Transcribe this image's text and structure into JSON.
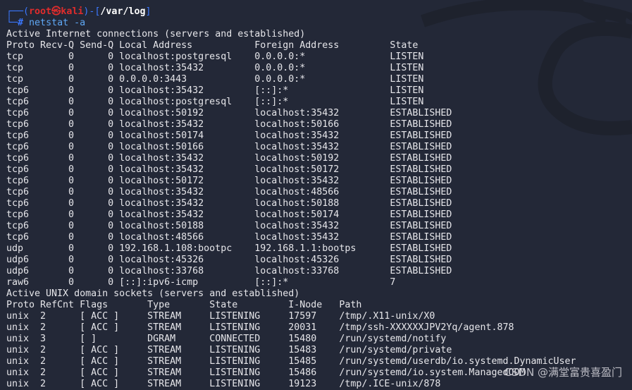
{
  "prompt": {
    "user": "root",
    "at_symbol": "㉿",
    "host": "kali",
    "cwd": "/var/log",
    "command": "netstat -a"
  },
  "inet": {
    "title": "Active Internet connections (servers and established)",
    "headers": [
      "Proto",
      "Recv-Q",
      "Send-Q",
      "Local Address",
      "Foreign Address",
      "State"
    ],
    "rows": [
      [
        "tcp",
        "0",
        "0",
        "localhost:postgresql",
        "0.0.0.0:*",
        "LISTEN"
      ],
      [
        "tcp",
        "0",
        "0",
        "localhost:35432",
        "0.0.0.0:*",
        "LISTEN"
      ],
      [
        "tcp",
        "0",
        "0",
        "0.0.0.0:3443",
        "0.0.0.0:*",
        "LISTEN"
      ],
      [
        "tcp6",
        "0",
        "0",
        "localhost:35432",
        "[::]:*",
        "LISTEN"
      ],
      [
        "tcp6",
        "0",
        "0",
        "localhost:postgresql",
        "[::]:*",
        "LISTEN"
      ],
      [
        "tcp6",
        "0",
        "0",
        "localhost:50192",
        "localhost:35432",
        "ESTABLISHED"
      ],
      [
        "tcp6",
        "0",
        "0",
        "localhost:35432",
        "localhost:50166",
        "ESTABLISHED"
      ],
      [
        "tcp6",
        "0",
        "0",
        "localhost:50174",
        "localhost:35432",
        "ESTABLISHED"
      ],
      [
        "tcp6",
        "0",
        "0",
        "localhost:50166",
        "localhost:35432",
        "ESTABLISHED"
      ],
      [
        "tcp6",
        "0",
        "0",
        "localhost:35432",
        "localhost:50192",
        "ESTABLISHED"
      ],
      [
        "tcp6",
        "0",
        "0",
        "localhost:35432",
        "localhost:50172",
        "ESTABLISHED"
      ],
      [
        "tcp6",
        "0",
        "0",
        "localhost:50172",
        "localhost:35432",
        "ESTABLISHED"
      ],
      [
        "tcp6",
        "0",
        "0",
        "localhost:35432",
        "localhost:48566",
        "ESTABLISHED"
      ],
      [
        "tcp6",
        "0",
        "0",
        "localhost:35432",
        "localhost:50188",
        "ESTABLISHED"
      ],
      [
        "tcp6",
        "0",
        "0",
        "localhost:35432",
        "localhost:50174",
        "ESTABLISHED"
      ],
      [
        "tcp6",
        "0",
        "0",
        "localhost:50188",
        "localhost:35432",
        "ESTABLISHED"
      ],
      [
        "tcp6",
        "0",
        "0",
        "localhost:48566",
        "localhost:35432",
        "ESTABLISHED"
      ],
      [
        "udp",
        "0",
        "0",
        "192.168.1.108:bootpc",
        "192.168.1.1:bootps",
        "ESTABLISHED"
      ],
      [
        "udp6",
        "0",
        "0",
        "localhost:45326",
        "localhost:45326",
        "ESTABLISHED"
      ],
      [
        "udp6",
        "0",
        "0",
        "localhost:33768",
        "localhost:33768",
        "ESTABLISHED"
      ],
      [
        "raw6",
        "0",
        "0",
        "[::]:ipv6-icmp",
        "[::]:*",
        "7"
      ]
    ]
  },
  "unix": {
    "title": "Active UNIX domain sockets (servers and established)",
    "headers": [
      "Proto",
      "RefCnt",
      "Flags",
      "Type",
      "State",
      "I-Node",
      "Path"
    ],
    "rows": [
      [
        "unix",
        "2",
        "[ ACC ]",
        "STREAM",
        "LISTENING",
        "17597",
        "/tmp/.X11-unix/X0"
      ],
      [
        "unix",
        "2",
        "[ ACC ]",
        "STREAM",
        "LISTENING",
        "20031",
        "/tmp/ssh-XXXXXXJPV2Yq/agent.878"
      ],
      [
        "unix",
        "3",
        "[ ]",
        "DGRAM",
        "CONNECTED",
        "15480",
        "/run/systemd/notify"
      ],
      [
        "unix",
        "2",
        "[ ACC ]",
        "STREAM",
        "LISTENING",
        "15483",
        "/run/systemd/private"
      ],
      [
        "unix",
        "2",
        "[ ACC ]",
        "STREAM",
        "LISTENING",
        "15485",
        "/run/systemd/userdb/io.systemd.DynamicUser"
      ],
      [
        "unix",
        "2",
        "[ ACC ]",
        "STREAM",
        "LISTENING",
        "15486",
        "/run/systemd/io.system.ManagedOOM"
      ],
      [
        "unix",
        "2",
        "[ ACC ]",
        "STREAM",
        "LISTENING",
        "19123",
        "/tmp/.ICE-unix/878"
      ]
    ]
  },
  "watermark": "CSDN @满堂富贵喜盈门",
  "colors": {
    "background": "#232837",
    "frame": "#3b78ff",
    "user": "#e02c2c",
    "command": "#5fa8f5"
  }
}
